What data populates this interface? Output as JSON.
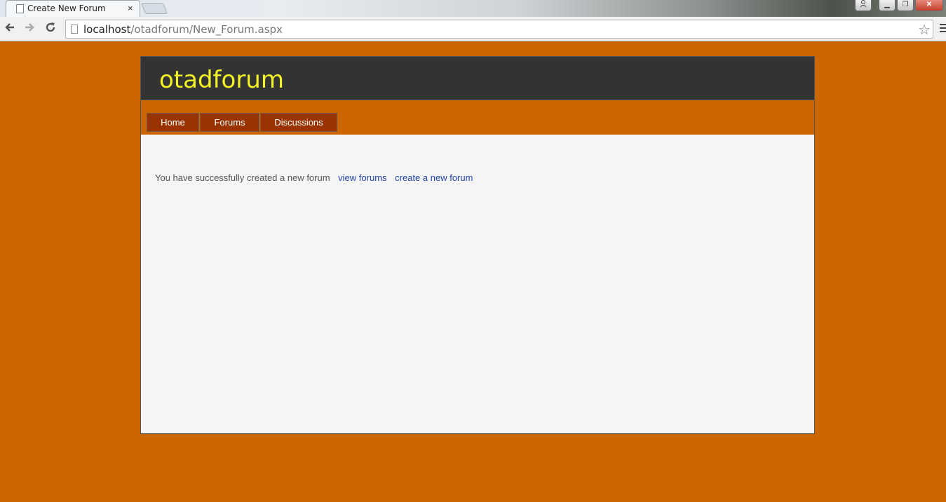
{
  "browser": {
    "tab_title": "Create New Forum",
    "tab_close": "×",
    "url_host": "localhost",
    "url_path": "/otadforum/New_Forum.aspx",
    "star": "☆"
  },
  "window_controls": {
    "minimize": "▁",
    "restore": "❐",
    "close": "✕"
  },
  "site": {
    "title": "otadforum"
  },
  "nav": {
    "home": "Home",
    "forums": "Forums",
    "discussions": "Discussions"
  },
  "content": {
    "message": "You have successfully created a new forum",
    "view_forums_link": "view forums",
    "create_forum_link": "create a new forum"
  },
  "colors": {
    "page_bg": "#cc6600",
    "header_bg": "#333333",
    "title_color": "#f3f325",
    "nav_bg": "#993300",
    "content_bg": "#f5f5f5",
    "link_color": "#2244aa"
  },
  "icons": [
    "back-arrow-icon",
    "forward-arrow-icon",
    "reload-icon",
    "page-icon",
    "star-icon",
    "menu-icon",
    "user-icon"
  ]
}
